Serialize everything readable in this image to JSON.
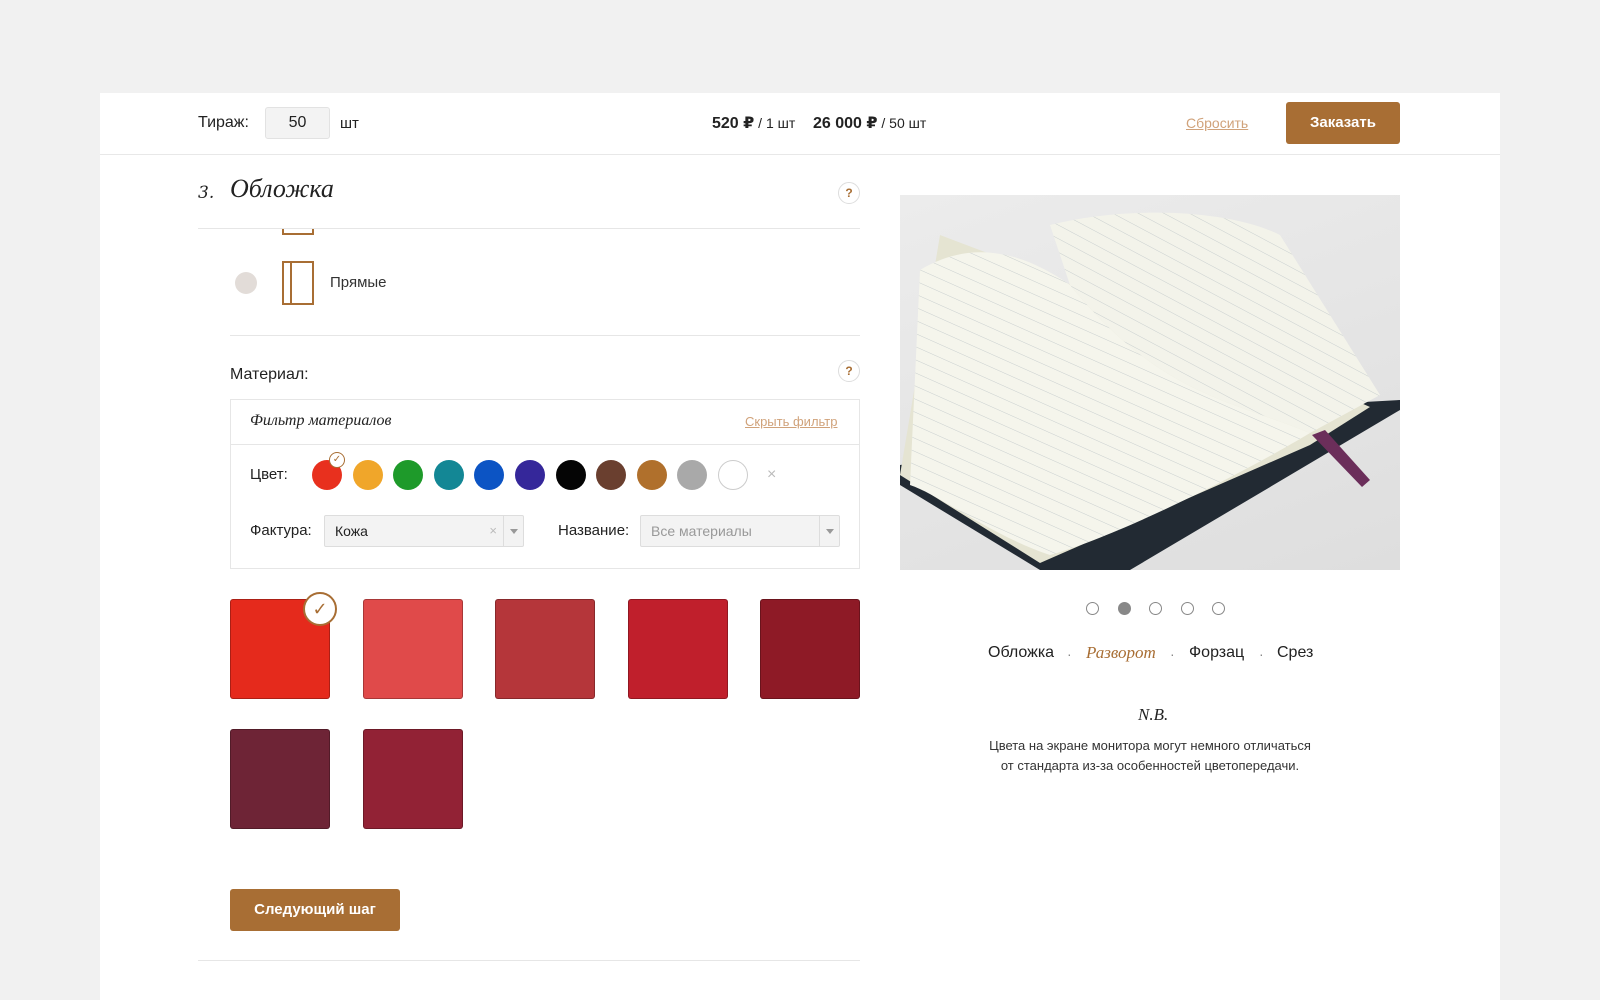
{
  "topbar": {
    "quantity_label": "Тираж:",
    "quantity_value": "50",
    "quantity_unit": "шт",
    "price_unit_value": "520 ₽",
    "price_unit_suffix": " / 1 шт",
    "price_total_value": "26 000 ₽",
    "price_total_suffix": " / 50 шт",
    "reset_label": "Сбросить",
    "order_label": "Заказать"
  },
  "step": {
    "number": "3.",
    "title": "Обложка",
    "help": "?"
  },
  "corners": {
    "option_label": "Прямые"
  },
  "material": {
    "label": "Материал:",
    "help": "?",
    "filter": {
      "title": "Фильтр материалов",
      "hide_label": "Скрыть фильтр",
      "color_label": "Цвет:",
      "colors": [
        "#e8301e",
        "#f0a62a",
        "#1e9a2a",
        "#138795",
        "#0c54c4",
        "#35279a",
        "#050505",
        "#6a3f2f",
        "#b0702c",
        "#a9a9a9",
        "#ffffff"
      ],
      "selected_color_index": 0,
      "clear_colors": "×",
      "texture_label": "Фактура:",
      "texture_value": "Кожа",
      "texture_clear": "×",
      "name_label": "Название:",
      "name_placeholder": "Все материалы"
    },
    "tiles": [
      {
        "color": "#e52a1c",
        "selected": true
      },
      {
        "color": "#e04a4a",
        "selected": false
      },
      {
        "color": "#b5363a",
        "selected": false
      },
      {
        "color": "#c01f2c",
        "selected": false
      },
      {
        "color": "#8e1a26",
        "selected": false
      },
      {
        "color": "#6e2436",
        "selected": false
      },
      {
        "color": "#922235",
        "selected": false
      }
    ]
  },
  "next_button": "Следующий шаг",
  "preview": {
    "slides_count": 5,
    "active_slide": 2,
    "views": [
      "Обложка",
      "Разворот",
      "Форзац",
      "Срез"
    ],
    "active_view": "Разворот",
    "separator": "·",
    "nb_title": "N.B.",
    "nb_line1": "Цвета на экране монитора могут немного отличаться",
    "nb_line2": "от стандарта из-за особенностей цветопередачи."
  }
}
